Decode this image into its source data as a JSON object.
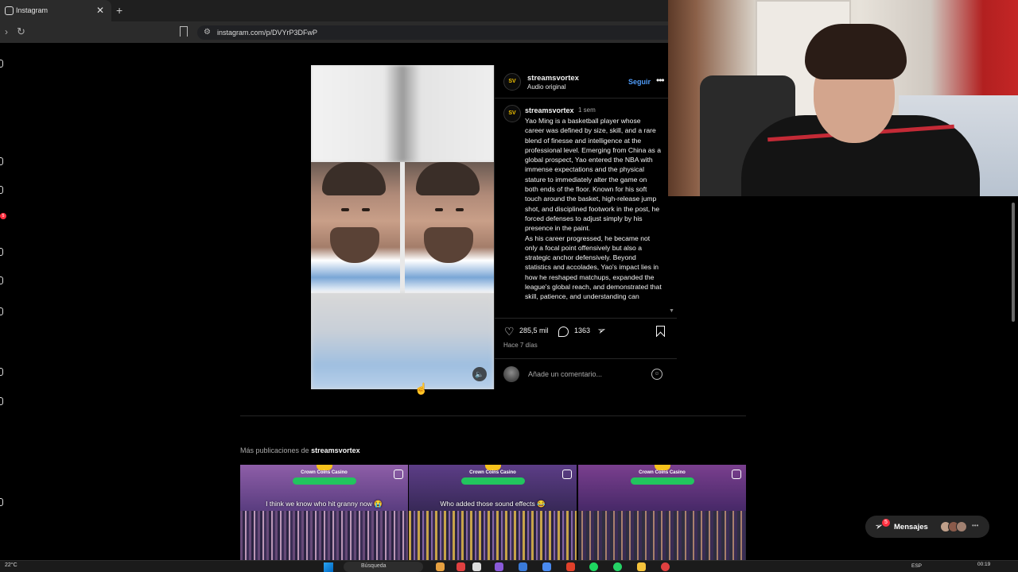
{
  "browser": {
    "tab_title": "Instagram",
    "close_tab": "✕",
    "new_tab": "+",
    "url": "instagram.com/p/DVYrP3DFwP"
  },
  "sidebar": {
    "notification_count": "5"
  },
  "post": {
    "header": {
      "username": "streamsvortex",
      "audio": "Audio original",
      "follow": "Seguir",
      "avatar_text": "SV"
    },
    "caption": {
      "username": "streamsvortex",
      "time": "1 sem",
      "text": "Yao Ming is a basketball player whose career was defined by size, skill, and a rare blend of finesse and intelligence at the professional level. Emerging from China as a global prospect, Yao entered the NBA with immense expectations and the physical stature to immediately alter the game on both ends of the floor. Known for his soft touch around the basket, high-release jump shot, and disciplined footwork in the post, he forced defenses to adjust simply by his presence in the paint.\nAs his career progressed, he became not only a focal point offensively but also a strategic anchor defensively. Beyond statistics and accolades, Yao's impact lies in how he reshaped matchups, expanded the league's global reach, and demonstrated that skill, patience, and understanding can"
    },
    "likes": "285,5 mil",
    "comments": "1363",
    "posted_ago": "Hace 7 días",
    "comment_placeholder": "Añade un comentario..."
  },
  "more_posts": {
    "title_prefix": "Más publicaciones de",
    "username": "streamsvortex",
    "items": [
      {
        "brand": "Crown Coins Casino",
        "caption": "I think we know who hit granny now 😭"
      },
      {
        "brand": "Crown Coins Casino",
        "caption": "Who added those sound effects 😂"
      },
      {
        "brand": "Crown Coins Casino",
        "caption": ""
      }
    ]
  },
  "messages": {
    "label": "Mensajes",
    "badge": "5"
  },
  "taskbar": {
    "weather": "22°C",
    "search_placeholder": "Búsqueda",
    "language": "ESP",
    "time": "00:19"
  },
  "colors": {
    "link_blue": "#4f9cf9",
    "notification_red": "#ff3040",
    "background": "#000000"
  }
}
